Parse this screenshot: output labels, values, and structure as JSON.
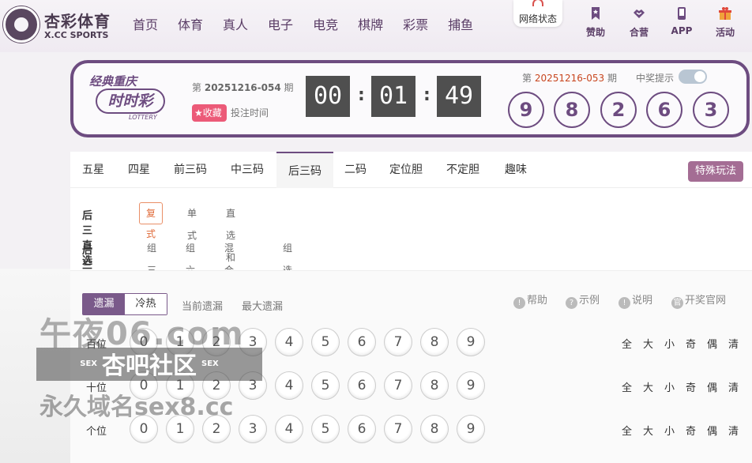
{
  "header": {
    "logo_name": "杏彩体育",
    "logo_sub": "X.CC SPORTS",
    "nav": [
      "首页",
      "体育",
      "真人",
      "电子",
      "电竞",
      "棋牌",
      "彩票",
      "捕鱼"
    ],
    "network_status": "网络状态",
    "tools": [
      {
        "label": "赞助",
        "icon": "bookmark-icon"
      },
      {
        "label": "合营",
        "icon": "handshake-icon"
      },
      {
        "label": "APP",
        "icon": "phone-icon"
      },
      {
        "label": "活动",
        "icon": "gift-icon"
      }
    ]
  },
  "draw": {
    "brand_top": "经典重庆",
    "brand_main": "时时彩",
    "brand_sub": "LOTTERY",
    "current_issue_prefix": "第",
    "current_issue": "20251216-054",
    "current_issue_suffix": "期",
    "favorite": "收藏",
    "countdown_label": "投注时间",
    "timer": [
      "00",
      "01",
      "49"
    ],
    "last_issue_prefix": "第",
    "last_issue": "20251216-053",
    "last_issue_suffix": "期",
    "notify_label": "中奖提示",
    "notify_on": true,
    "result": [
      "9",
      "8",
      "2",
      "6",
      "3"
    ]
  },
  "play": {
    "tabs": [
      "五星",
      "四星",
      "前三码",
      "中三码",
      "后三码",
      "二码",
      "定位胆",
      "不定胆",
      "趣味"
    ],
    "active_tab": "后三码",
    "special_button": "特殊玩法",
    "direct_title": "后三直选",
    "direct_options": [
      "复式",
      "单式",
      "直选和值"
    ],
    "group_title": "后三组选",
    "group_options": [
      "组三",
      "组六",
      "混合组选",
      "组选和值"
    ]
  },
  "stats": {
    "seg_on": "遗漏",
    "seg_off": "冷热",
    "current_miss": "当前遗漏",
    "max_miss": "最大遗漏",
    "help": [
      "帮助",
      "示例",
      "说明",
      "开奖官网"
    ]
  },
  "picker": {
    "rows": [
      "百位",
      "十位",
      "个位"
    ],
    "digits": [
      "0",
      "1",
      "2",
      "3",
      "4",
      "5",
      "6",
      "7",
      "8",
      "9"
    ],
    "quick": [
      "全",
      "大",
      "小",
      "奇",
      "偶",
      "清"
    ]
  },
  "watermark": {
    "line1": "午夜06.com",
    "line2_tag": "SEX",
    "line2": "杏吧社区",
    "line3": "永久域名sex8.cc"
  }
}
